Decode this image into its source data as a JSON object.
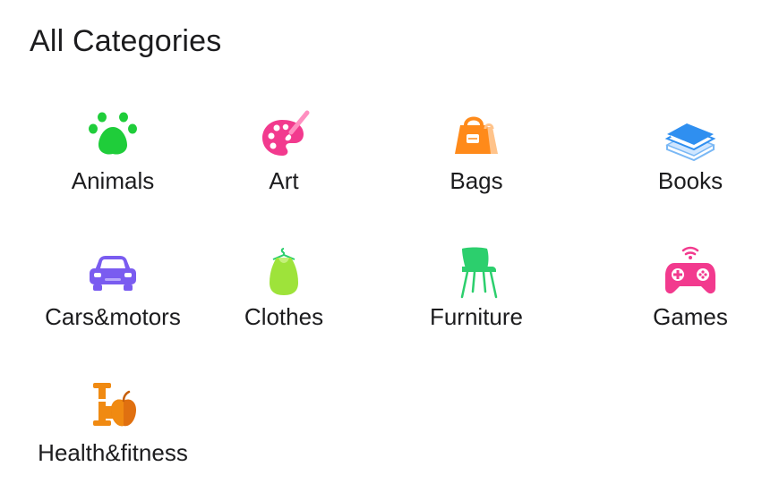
{
  "header": {
    "title": "All Categories"
  },
  "categories": [
    {
      "label": "Animals",
      "icon": "paw-icon",
      "color": "#1fcd3a"
    },
    {
      "label": "Art",
      "icon": "paint-palette-icon",
      "color": "#f23a8e"
    },
    {
      "label": "Bags",
      "icon": "handbag-icon",
      "color": "#ff8a1a"
    },
    {
      "label": "Books",
      "icon": "books-icon",
      "color": "#2f8ff0"
    },
    {
      "label": "Cars&motors",
      "icon": "car-icon",
      "color": "#7a5cf0"
    },
    {
      "label": "Clothes",
      "icon": "dress-hanger-icon",
      "color": "#9ee33a"
    },
    {
      "label": "Furniture",
      "icon": "chair-icon",
      "color": "#2ccf6d"
    },
    {
      "label": "Games",
      "icon": "gamepad-icon",
      "color": "#f23a8e"
    },
    {
      "label": "Health&fitness",
      "icon": "dumbbell-apple-icon",
      "color": "#f08a12"
    }
  ]
}
